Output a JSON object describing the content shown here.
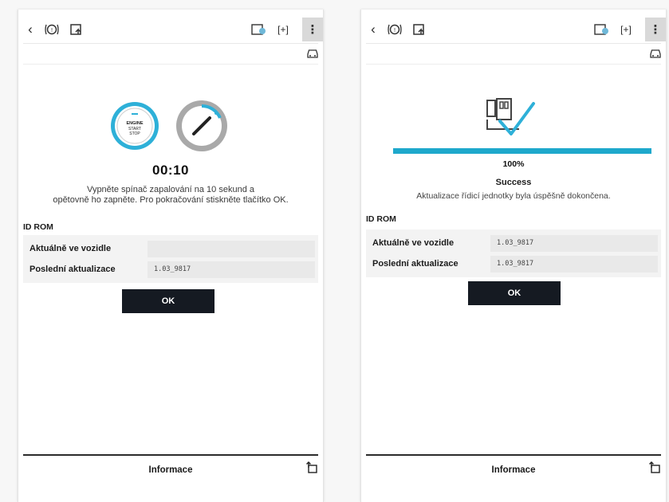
{
  "left": {
    "start_button": {
      "line1": "ENGINE",
      "line2": "START",
      "line3": "STOP"
    },
    "timer": "00:10",
    "instruction_line1": "Vypněte spínač zapalování na 10 sekund a",
    "instruction_line2": "opětovně ho zapněte. Pro pokračování stiskněte tlačítko OK.",
    "section_label": "ID ROM",
    "rows": [
      {
        "label": "Aktuálně ve vozidle",
        "value": ""
      },
      {
        "label": "Poslední aktualizace",
        "value": "1.03_9817"
      }
    ],
    "ok_label": "OK",
    "footer_title": "Informace"
  },
  "right": {
    "progress_percent": 100,
    "progress_label": "100%",
    "status_title": "Success",
    "status_message": "Aktualizace řídicí jednotky byla úspěšně dokončena.",
    "section_label": "ID ROM",
    "rows": [
      {
        "label": "Aktuálně ve vozidle",
        "value": "1.03_9817"
      },
      {
        "label": "Poslední aktualizace",
        "value": "1.03_9817"
      }
    ],
    "ok_label": "OK",
    "footer_title": "Informace"
  },
  "icons": {
    "back": "chevron-left-icon",
    "brake": "brake-warning-icon",
    "ecu": "ecu-update-icon",
    "dtc": "dtc-icon",
    "expand": "expand-icon",
    "menu": "kebab-menu-icon",
    "vehicle": "vehicle-icon",
    "export": "export-icon"
  },
  "colors": {
    "accent": "#1ea8cc",
    "button": "#151a22"
  }
}
